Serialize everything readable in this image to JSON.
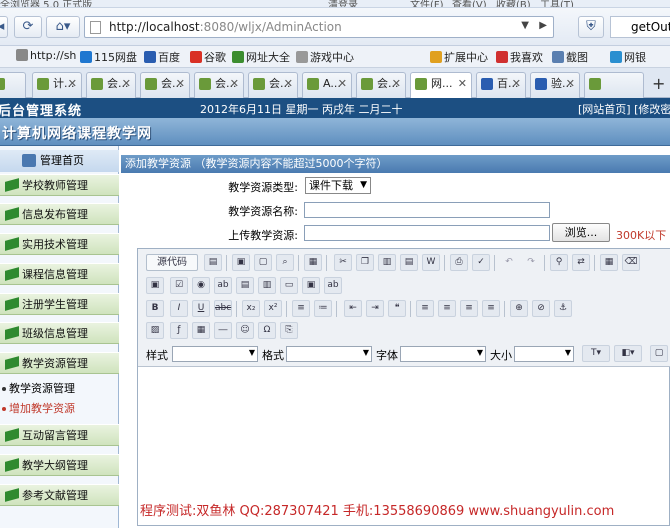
{
  "browser": {
    "title_fragment": "全浏览器 5.0 正式版",
    "title_right": [
      "清登录",
      "文件(F)",
      "查看(V)",
      "收藏(B)",
      "工具(T)"
    ],
    "url_host": "http://localhost",
    "url_rest": ":8080/wljx/AdminAction",
    "side_tab": "getOut"
  },
  "bookmarks": {
    "left": [
      "http://sh",
      "115网盘",
      "百度",
      "谷歌",
      "网址大全",
      "游戏中心"
    ],
    "right": [
      "扩展中心",
      "我喜欢",
      "截图",
      "网银"
    ]
  },
  "tabs": [
    "",
    "计...",
    "会...",
    "会...",
    "会...",
    "会...",
    "A...",
    "会...",
    "网...",
    "百...",
    "验..."
  ],
  "header": {
    "title": "后台管理系统",
    "date": "2012年6月11日 星期一 丙戌年 二月二十",
    "links": "[网站首页] [修改密"
  },
  "banner": {
    "title": "计算机网络课程教学网"
  },
  "sidebar": {
    "home": "管理首页",
    "items_top": [
      "学校教师管理",
      "信息发布管理",
      "实用技术管理",
      "课程信息管理",
      "注册学生管理",
      "班级信息管理",
      "教学资源管理"
    ],
    "subitems": [
      {
        "label": "教学资源管理",
        "color": "#000000"
      },
      {
        "label": "增加教学资源",
        "color": "#c0392b"
      }
    ],
    "items_bottom": [
      "互动留言管理",
      "教学大纲管理",
      "参考文献管理"
    ]
  },
  "panel": {
    "title": "添加教学资源 （教学资源内容不能超过5000个字符）"
  },
  "form": {
    "type_label": "教学资源类型:",
    "type_value": "课件下载",
    "name_label": "教学资源名称:",
    "name_value": "",
    "upload_label": "上传教学资源:",
    "browse_label": "浏览...",
    "size_note": "300K以下"
  },
  "editor": {
    "source_label": "源代码",
    "style_label": "样式",
    "format_label": "格式",
    "font_label": "字体",
    "size_label": "大小"
  },
  "footer": {
    "note": "程序测试:双鱼林 QQ:287307421 手机:13558690869 www.shuangyulin.com"
  }
}
